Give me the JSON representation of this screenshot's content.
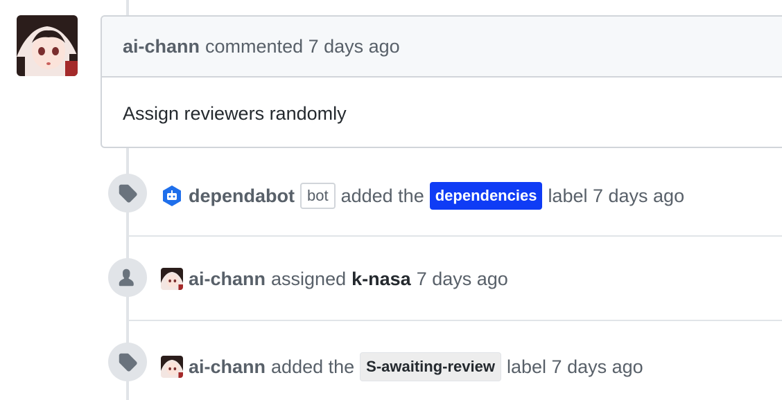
{
  "comment": {
    "author": "ai-chann",
    "meta": "commented 7 days ago",
    "body": "Assign reviewers randomly"
  },
  "events": [
    {
      "icon": "tag-icon",
      "actor": "dependabot",
      "actor_badge": "bot",
      "action": "added the",
      "label": "dependencies",
      "label_bg": "#0f3cf5",
      "label_fg": "#ffffff",
      "suffix": "label 7 days ago"
    },
    {
      "icon": "person-icon",
      "actor": "ai-chann",
      "action": "assigned",
      "target": "k-nasa",
      "suffix": "7 days ago"
    },
    {
      "icon": "tag-icon",
      "actor": "ai-chann",
      "action": "added the",
      "label": "S-awaiting-review",
      "label_bg": "#ededed",
      "label_fg": "#24292e",
      "suffix": "label 7 days ago"
    }
  ],
  "colors": {
    "timeline": "#e1e4e8",
    "dependabot_brand": "#0366d6"
  }
}
